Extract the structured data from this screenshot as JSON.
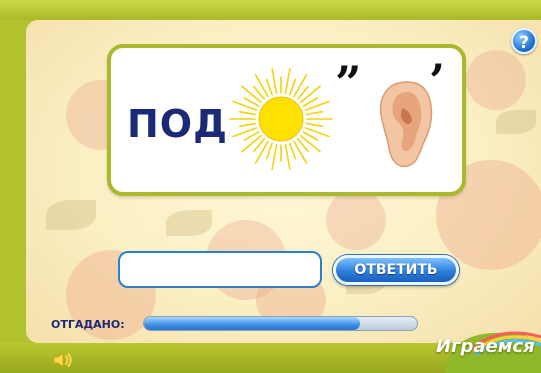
{
  "game": {
    "help_button_label": "?",
    "puzzle": {
      "prefix_word": "ПОД",
      "quote_marks": "”",
      "apostrophe": "’",
      "pictures": [
        "sun-icon",
        "ear-icon"
      ]
    },
    "answer": {
      "input_value": "",
      "button_label": "ОТВЕТИТЬ"
    },
    "progress": {
      "label": "ОТГАДАНО:",
      "fraction": 0.79
    },
    "logo_text": "Играемся"
  },
  "colors": {
    "frame": "#b2c22e",
    "panel": "#fbefc4",
    "accent_blue": "#2f7fdc",
    "text_dark_blue": "#1a2a78",
    "sun": "#ffd400"
  }
}
